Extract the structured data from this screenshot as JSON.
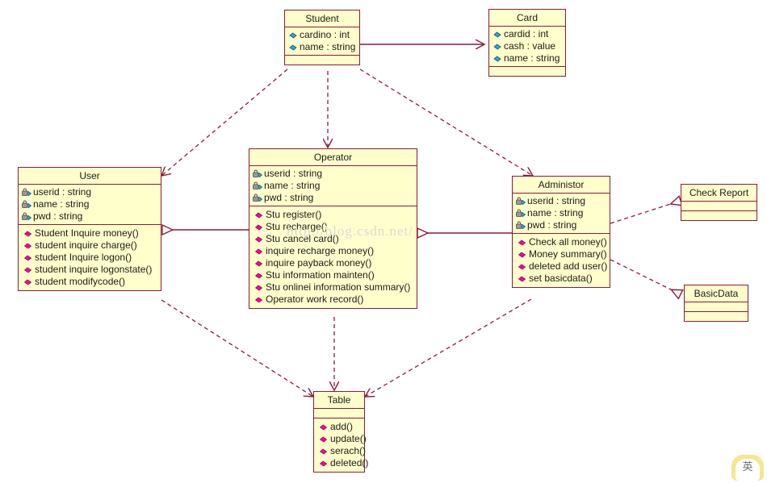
{
  "diagram": {
    "type": "uml-class-diagram",
    "background": "#ffffff",
    "class_fill": "#ffffcc",
    "class_border": "#8b1a3a",
    "line_color": "#8b1a3a",
    "public_attr_icon_color": "#29a8e0",
    "private_attr_icon": "lock-diamond-icon",
    "operation_icon_color": "#ff00aa",
    "watermark": "http://blog.csdn.net/",
    "corner_badge_glyph": "英"
  },
  "classes": [
    {
      "id": "student",
      "name": "Student",
      "attributes": [
        {
          "icon": "public-attribute-icon",
          "text": "cardino : int"
        },
        {
          "icon": "public-attribute-icon",
          "text": "name : string"
        }
      ],
      "operations": []
    },
    {
      "id": "card",
      "name": "Card",
      "attributes": [
        {
          "icon": "public-attribute-icon",
          "text": "cardid : int"
        },
        {
          "icon": "public-attribute-icon",
          "text": "cash : value"
        },
        {
          "icon": "public-attribute-icon",
          "text": "name : string"
        }
      ],
      "operations": []
    },
    {
      "id": "user",
      "name": "User",
      "attributes": [
        {
          "icon": "private-attribute-icon",
          "text": "userid : string"
        },
        {
          "icon": "private-attribute-icon",
          "text": "name : string"
        },
        {
          "icon": "private-attribute-icon",
          "text": "pwd  : string"
        }
      ],
      "operations": [
        {
          "icon": "operation-icon",
          "text": "Student Inquire money()"
        },
        {
          "icon": "operation-icon",
          "text": "student inquire charge()"
        },
        {
          "icon": "operation-icon",
          "text": "student Inquire logon()"
        },
        {
          "icon": "operation-icon",
          "text": "student inquire logonstate()"
        },
        {
          "icon": "operation-icon",
          "text": "student modifycode()"
        }
      ]
    },
    {
      "id": "operator",
      "name": "Operator",
      "attributes": [
        {
          "icon": "private-attribute-icon",
          "text": "userid : string"
        },
        {
          "icon": "private-attribute-icon",
          "text": "name : string"
        },
        {
          "icon": "private-attribute-icon",
          "text": "pwd : string"
        }
      ],
      "operations": [
        {
          "icon": "operation-icon",
          "text": "Stu register()"
        },
        {
          "icon": "operation-icon",
          "text": "Stu recharge()"
        },
        {
          "icon": "operation-icon",
          "text": "Stu cancel card()"
        },
        {
          "icon": "operation-icon",
          "text": "inquire recharge money()"
        },
        {
          "icon": "operation-icon",
          "text": "inquire payback money()"
        },
        {
          "icon": "operation-icon",
          "text": "Stu information mainten()"
        },
        {
          "icon": "operation-icon",
          "text": "Stu onlinei information summary()"
        },
        {
          "icon": "operation-icon",
          "text": "Operator work record()"
        }
      ]
    },
    {
      "id": "administor",
      "name": "Administor",
      "attributes": [
        {
          "icon": "private-attribute-icon",
          "text": "userid : string"
        },
        {
          "icon": "private-attribute-icon",
          "text": "name : string"
        },
        {
          "icon": "private-attribute-icon",
          "text": "pwd : string"
        }
      ],
      "operations": [
        {
          "icon": "operation-icon",
          "text": "Check all money()"
        },
        {
          "icon": "operation-icon",
          "text": "Money summary()"
        },
        {
          "icon": "operation-icon",
          "text": "deleted add user()"
        },
        {
          "icon": "operation-icon",
          "text": "set basicdata()"
        }
      ]
    },
    {
      "id": "check-report",
      "name": "Check Report",
      "attributes": [],
      "operations": []
    },
    {
      "id": "basicdata",
      "name": "BasicData",
      "attributes": [],
      "operations": []
    },
    {
      "id": "table",
      "name": "Table",
      "attributes": [],
      "operations": [
        {
          "icon": "operation-icon",
          "text": "add()"
        },
        {
          "icon": "operation-icon",
          "text": "update()"
        },
        {
          "icon": "operation-icon",
          "text": "serach()"
        },
        {
          "icon": "operation-icon",
          "text": "deleted()"
        }
      ]
    }
  ],
  "relations": [
    {
      "from": "student",
      "to": "card",
      "kind": "association"
    },
    {
      "from": "student",
      "to": "user",
      "kind": "dependency"
    },
    {
      "from": "student",
      "to": "operator",
      "kind": "dependency"
    },
    {
      "from": "student",
      "to": "administor",
      "kind": "dependency"
    },
    {
      "from": "operator",
      "to": "user",
      "kind": "generalization"
    },
    {
      "from": "administor",
      "to": "operator",
      "kind": "generalization"
    },
    {
      "from": "administor",
      "to": "check-report",
      "kind": "dependency"
    },
    {
      "from": "administor",
      "to": "basicdata",
      "kind": "dependency"
    },
    {
      "from": "operator",
      "to": "table",
      "kind": "dependency"
    },
    {
      "from": "user",
      "to": "table",
      "kind": "dependency"
    },
    {
      "from": "administor",
      "to": "table",
      "kind": "dependency"
    }
  ]
}
